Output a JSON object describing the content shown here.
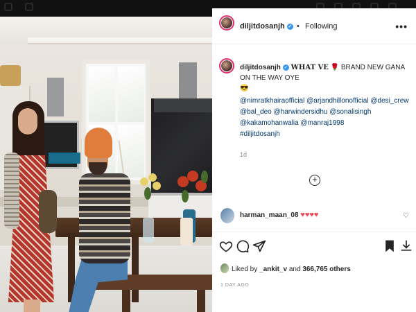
{
  "post": {
    "username": "diljitdosanjh",
    "separator": "•",
    "follow_status": "Following",
    "more_label": "•••",
    "caption_user": "diljitdosanjh",
    "caption_title": "WHAT VE",
    "caption_rest": "BRAND NEW GANA ON THE WAY OYE",
    "caption_emoji": "😎",
    "mentions": "@nimratkhairaofficial @arjandhillonofficial @desi_crew @bal_deo @harwindersidhu @sonalisingh @kakamohanwalia @manraj1998",
    "hashtag": "#diljitdosanjh",
    "age": "1d",
    "load_more_label": "+",
    "comment_user": "harman_maan_08",
    "comment_text": "♥♥♥♥",
    "likes_prefix": "Liked by",
    "likes_user": "_ankit_v",
    "likes_mid": "and",
    "likes_count": "366,765 others",
    "date": "1 DAY AGO"
  },
  "colors": {
    "accent_blue": "#3897f0",
    "link_blue": "#00376b",
    "heart_red": "#ed4956",
    "text": "#262626",
    "muted": "#8e8e8e"
  },
  "icons": {
    "like": "heart-icon",
    "comment": "comment-icon",
    "share": "send-icon",
    "save": "bookmark-icon",
    "download": "download-icon",
    "more": "more-icon",
    "verified": "verified-badge-icon"
  }
}
